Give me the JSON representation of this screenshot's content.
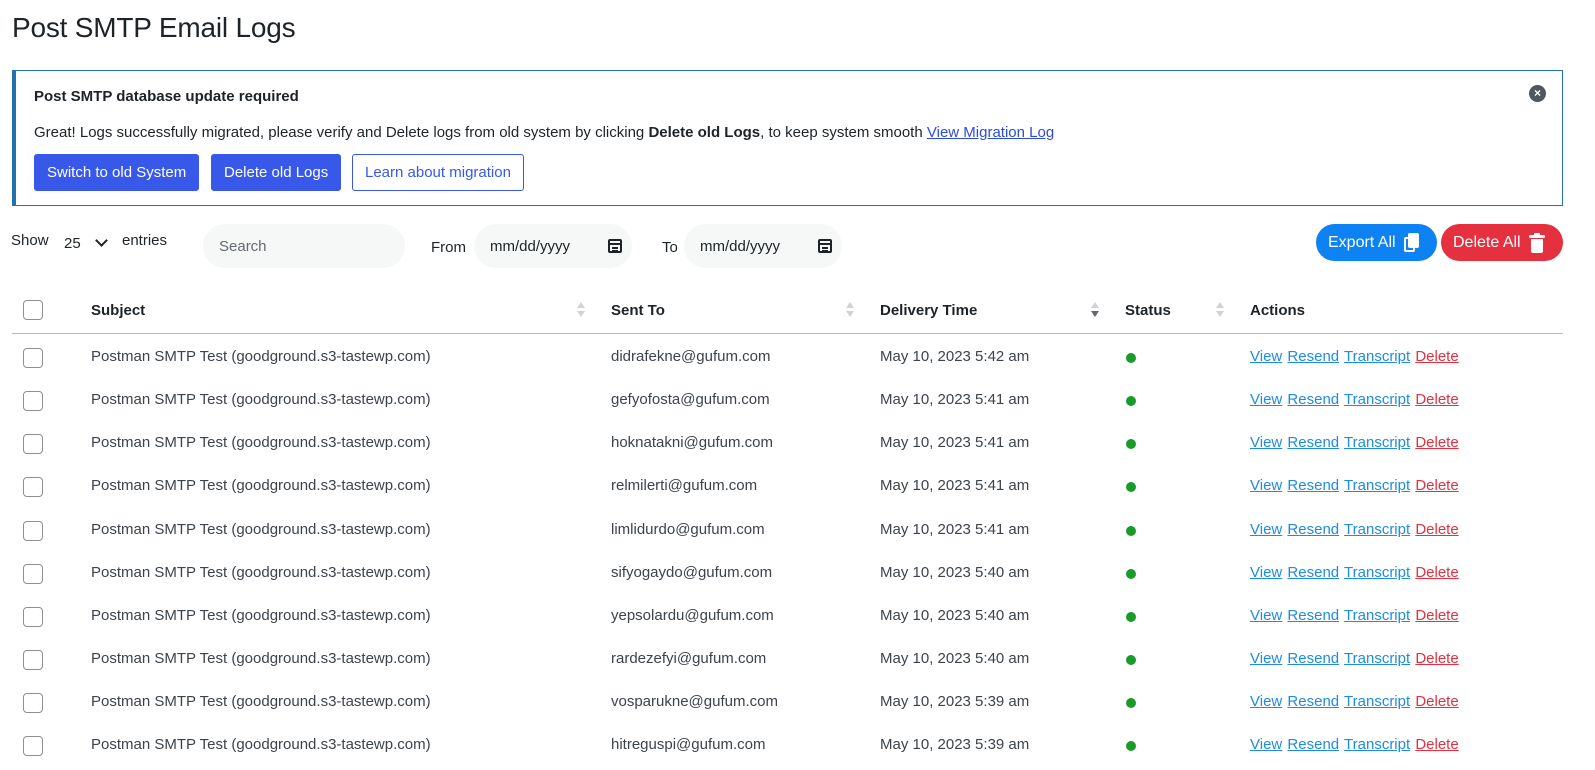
{
  "page": {
    "title": "Post SMTP Email Logs"
  },
  "notice": {
    "title": "Post SMTP database update required",
    "text_before": "Great! Logs successfully migrated, please verify and Delete logs from old system by clicking ",
    "text_bold": "Delete old Logs",
    "text_after": ", to keep system smooth ",
    "link": "View Migration Log",
    "close_icon": "close-circle-icon",
    "buttons": {
      "switch": "Switch to old System",
      "delete_old": "Delete old Logs",
      "learn": "Learn about migration"
    }
  },
  "toolbar": {
    "show_label": "Show",
    "entries_value": "25",
    "entries_label": "entries",
    "search_placeholder": "Search",
    "from_label": "From",
    "from_placeholder": "mm/dd/yyyy",
    "to_label": "To",
    "to_placeholder": "mm/dd/yyyy",
    "export_label": "Export All",
    "delete_all_label": "Delete All"
  },
  "colors": {
    "primary": "#3858e9",
    "export": "#0d82f2",
    "danger": "#e5303f",
    "status_success": "#1a9a2a",
    "link": "#1e8be6"
  },
  "table": {
    "columns": {
      "subject": "Subject",
      "sent_to": "Sent To",
      "delivery_time": "Delivery Time",
      "status": "Status",
      "actions": "Actions"
    },
    "action_labels": {
      "view": "View",
      "resend": "Resend",
      "transcript": "Transcript",
      "delete": "Delete"
    },
    "rows": [
      {
        "subject": "Postman SMTP Test (goodground.s3-tastewp.com)",
        "sent_to": "didrafekne@gufum.com",
        "time": "May 10, 2023 5:42 am",
        "status": "success"
      },
      {
        "subject": "Postman SMTP Test (goodground.s3-tastewp.com)",
        "sent_to": "gefyofosta@gufum.com",
        "time": "May 10, 2023 5:41 am",
        "status": "success"
      },
      {
        "subject": "Postman SMTP Test (goodground.s3-tastewp.com)",
        "sent_to": "hoknatakni@gufum.com",
        "time": "May 10, 2023 5:41 am",
        "status": "success"
      },
      {
        "subject": "Postman SMTP Test (goodground.s3-tastewp.com)",
        "sent_to": "relmilerti@gufum.com",
        "time": "May 10, 2023 5:41 am",
        "status": "success"
      },
      {
        "subject": "Postman SMTP Test (goodground.s3-tastewp.com)",
        "sent_to": "limlidurdo@gufum.com",
        "time": "May 10, 2023 5:41 am",
        "status": "success"
      },
      {
        "subject": "Postman SMTP Test (goodground.s3-tastewp.com)",
        "sent_to": "sifyogaydo@gufum.com",
        "time": "May 10, 2023 5:40 am",
        "status": "success"
      },
      {
        "subject": "Postman SMTP Test (goodground.s3-tastewp.com)",
        "sent_to": "yepsolardu@gufum.com",
        "time": "May 10, 2023 5:40 am",
        "status": "success"
      },
      {
        "subject": "Postman SMTP Test (goodground.s3-tastewp.com)",
        "sent_to": "rardezefyi@gufum.com",
        "time": "May 10, 2023 5:40 am",
        "status": "success"
      },
      {
        "subject": "Postman SMTP Test (goodground.s3-tastewp.com)",
        "sent_to": "vosparukne@gufum.com",
        "time": "May 10, 2023 5:39 am",
        "status": "success"
      },
      {
        "subject": "Postman SMTP Test (goodground.s3-tastewp.com)",
        "sent_to": "hitreguspi@gufum.com",
        "time": "May 10, 2023 5:39 am",
        "status": "success"
      }
    ]
  }
}
